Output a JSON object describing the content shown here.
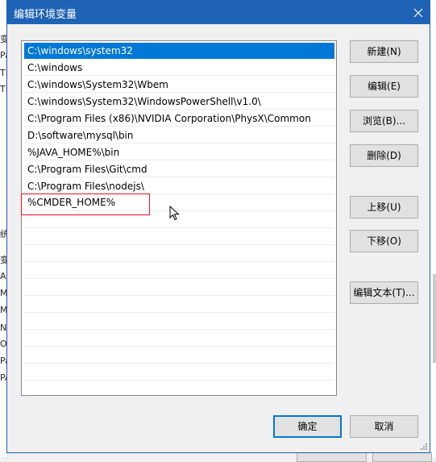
{
  "dialog": {
    "title": "编辑环境变量"
  },
  "path_entries": [
    "C:\\windows\\system32",
    "C:\\windows",
    "C:\\windows\\System32\\Wbem",
    "C:\\windows\\System32\\WindowsPowerShell\\v1.0\\",
    "C:\\Program Files (x86)\\NVIDIA Corporation\\PhysX\\Common",
    "D:\\software\\mysql\\bin",
    "%JAVA_HOME%\\bin",
    "C:\\Program Files\\Git\\cmd",
    "C:\\Program Files\\nodejs\\"
  ],
  "selected_index": 0,
  "editing_value": "%CMDER_HOME%",
  "buttons": {
    "new": "新建(N)",
    "edit": "编辑(E)",
    "browse": "浏览(B)...",
    "delete": "删除(D)",
    "move_up": "上移(U)",
    "move_down": "下移(O)",
    "edit_text": "编辑文本(T)...",
    "ok": "确定",
    "cancel": "取消"
  },
  "background_fragments": [
    "变",
    "Pa",
    "TE",
    "TM",
    "统",
    "变",
    "A",
    "M",
    "M",
    "N",
    "O",
    "Pa",
    "PA"
  ],
  "colors": {
    "titlebar": "#1f63b6",
    "selection": "#0078d7",
    "highlight_box": "#e81123"
  }
}
